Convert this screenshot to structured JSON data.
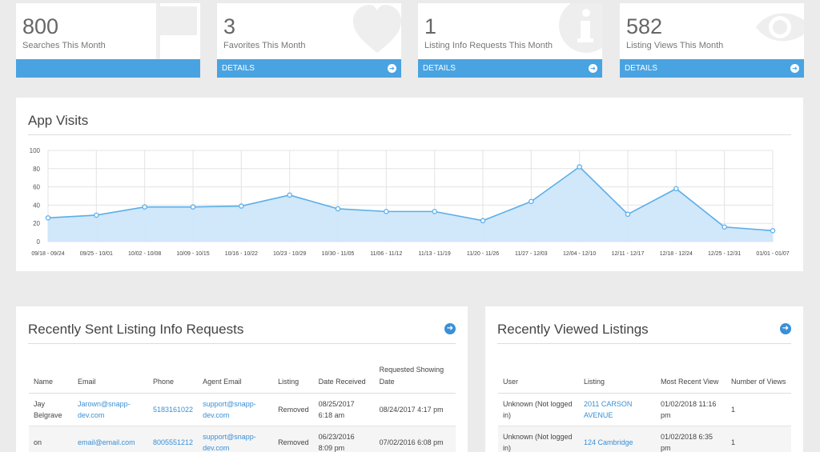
{
  "stats": [
    {
      "value": "800",
      "label": "Searches This Month",
      "footer": "",
      "icon": "flag-icon"
    },
    {
      "value": "3",
      "label": "Favorites This Month",
      "footer": "DETAILS",
      "icon": "heart-icon"
    },
    {
      "value": "1",
      "label": "Listing Info Requests This Month",
      "footer": "DETAILS",
      "icon": "info-icon"
    },
    {
      "value": "582",
      "label": "Listing Views This Month",
      "footer": "DETAILS",
      "icon": "eye-icon"
    }
  ],
  "colors": {
    "accent": "#4aa3e1",
    "line": "#5aaee8",
    "area": "#cfe6fa"
  },
  "visits": {
    "title": "App Visits"
  },
  "chart_data": {
    "type": "area",
    "title": "App Visits",
    "x": [
      "09/18 - 09/24",
      "09/25 - 10/01",
      "10/02 - 10/08",
      "10/09 - 10/15",
      "10/16 - 10/22",
      "10/23 - 10/29",
      "10/30 - 11/05",
      "11/06 - 11/12",
      "11/13 - 11/19",
      "11/20 - 11/26",
      "11/27 - 12/03",
      "12/04 - 12/10",
      "12/11 - 12/17",
      "12/18 - 12/24",
      "12/25 - 12/31",
      "01/01 - 01/07"
    ],
    "values": [
      26,
      29,
      38,
      38,
      39,
      51,
      36,
      33,
      33,
      23,
      44,
      82,
      30,
      58,
      16,
      12
    ],
    "yticks": [
      "100",
      "80",
      "60",
      "40",
      "20",
      "0"
    ],
    "ylim": [
      0,
      100
    ],
    "grid": true
  },
  "requests": {
    "title": "Recently Sent Listing Info Requests",
    "headers": [
      "Name",
      "Email",
      "Phone",
      "Agent Email",
      "Listing",
      "Date Received",
      "Requested Showing Date"
    ],
    "rows": [
      [
        "Jay Belgrave",
        "Jarown@snapp-dev.com",
        "5183161022",
        "support@snapp-dev.com",
        "Removed",
        "08/25/2017 6:18 am",
        "08/24/2017 4:17 pm"
      ],
      [
        "on",
        "email@email.com",
        "8005551212",
        "support@snapp-dev.com",
        "Removed",
        "06/23/2016 8:09 pm",
        "07/02/2016 6:08 pm"
      ]
    ]
  },
  "viewed": {
    "title": "Recently Viewed Listings",
    "headers": [
      "User",
      "Listing",
      "Most Recent View",
      "Number of Views"
    ],
    "rows": [
      [
        "Unknown (Not logged in)",
        "2011 CARSON AVENUE",
        "01/02/2018 11:16 pm",
        "1"
      ],
      [
        "Unknown (Not logged in)",
        "124 Cambridge",
        "01/02/2018 6:35 pm",
        "1"
      ]
    ]
  }
}
